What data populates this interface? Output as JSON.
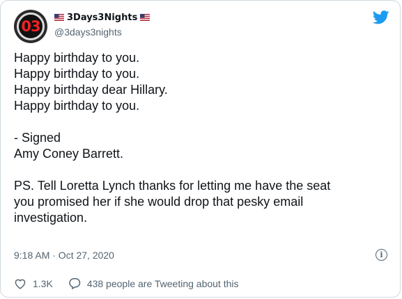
{
  "tweet": {
    "author": {
      "display_name": "3Days3Nights",
      "handle": "@3days3nights",
      "avatar_text": "03"
    },
    "body_lines": [
      "Happy birthday to you.",
      "Happy birthday to you.",
      "Happy birthday dear Hillary.",
      "Happy birthday to you.",
      "",
      "- Signed",
      "Amy Coney Barrett.",
      "",
      "PS. Tell Loretta Lynch thanks for letting me have the seat",
      "you promised her if she would drop that pesky email",
      "investigation."
    ],
    "timestamp": "9:18 AM · Oct 27, 2020",
    "likes": "1.3K",
    "reply_text": "438 people are Tweeting about this"
  },
  "icons": {
    "brand": "twitter-bird-icon",
    "flag": "us-flag-icon",
    "info": "info-icon",
    "like": "heart-icon",
    "reply": "speech-bubble-icon"
  },
  "colors": {
    "brand_blue": "#1d9bf0",
    "secondary_text": "#536471",
    "border": "#cfd9de"
  }
}
